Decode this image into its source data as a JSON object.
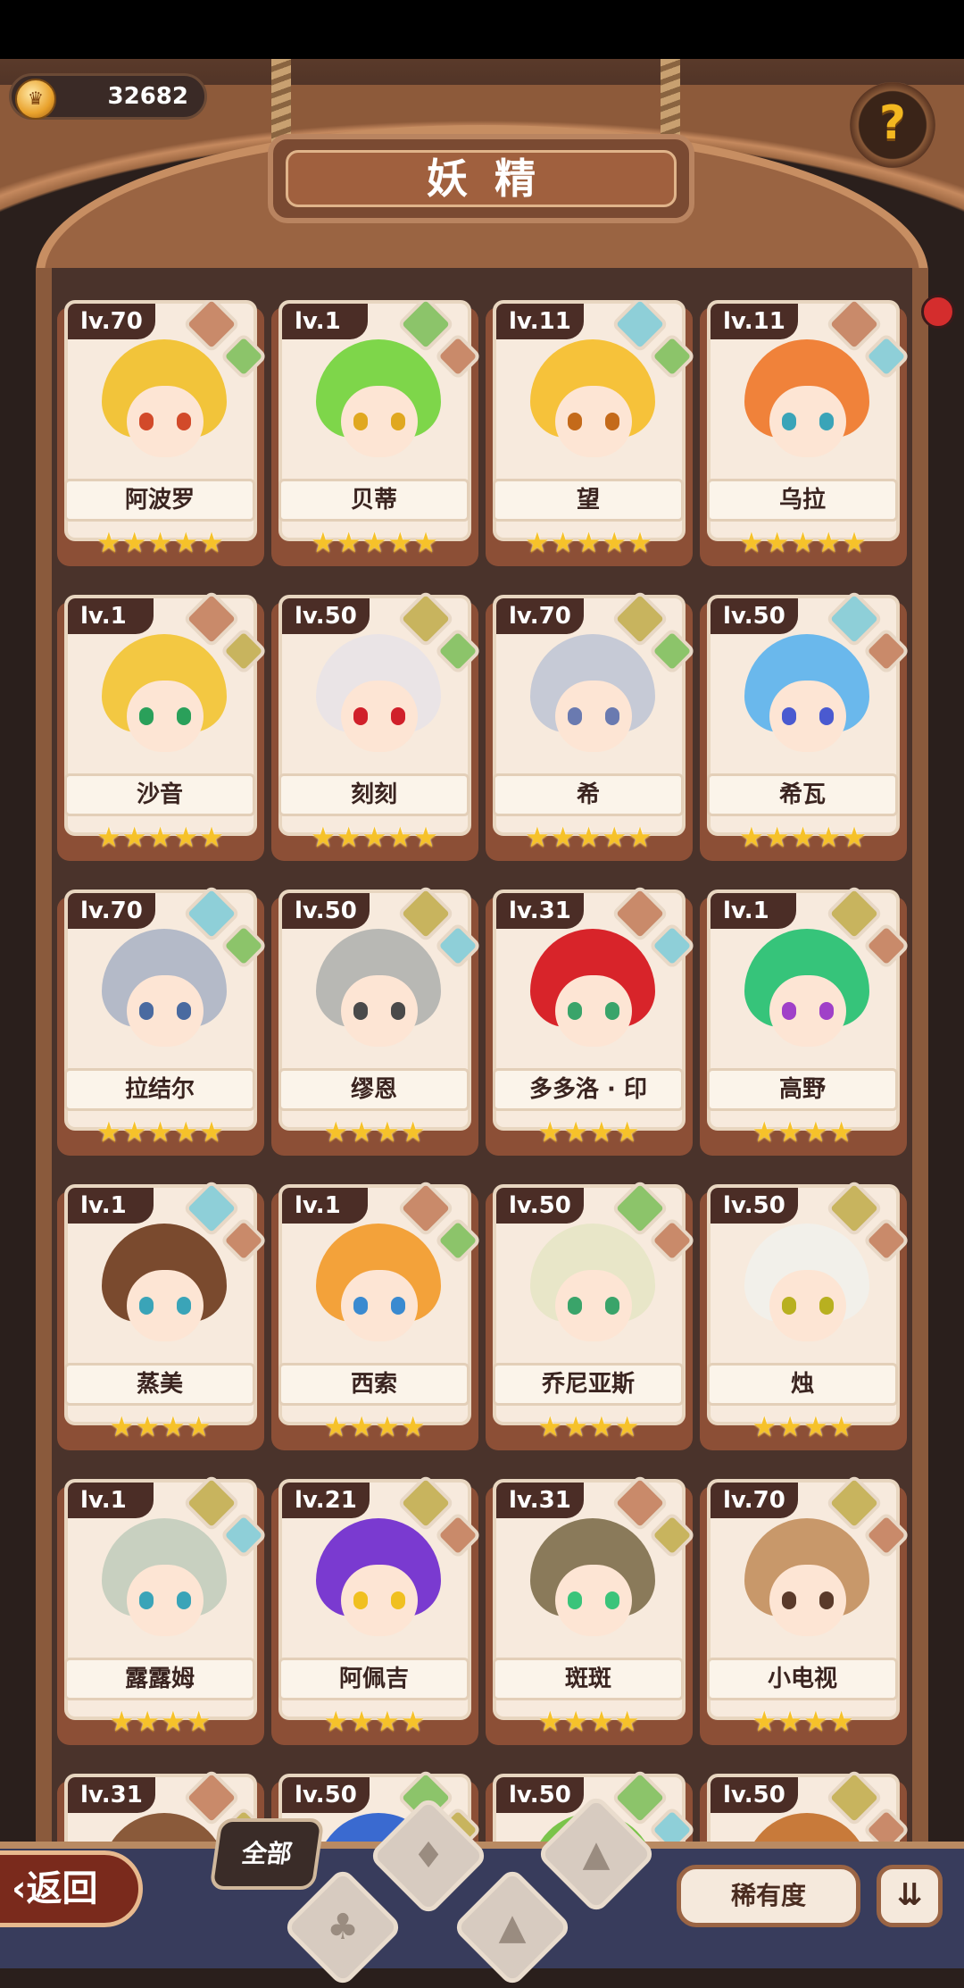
{
  "header": {
    "coins": "32682",
    "title": "妖精",
    "help_icon": "question-sprout-icon"
  },
  "colors": {
    "card_bg": "#f7eadd",
    "card_frame": "#8c4f36",
    "level_tag": "#4b2d26",
    "star": "#f6c22a",
    "bottom_bar": "#383c5c",
    "element_fire": "#c98a6a",
    "element_plant": "#8cc46a",
    "element_water": "#8ecfd8",
    "element_earth": "#c8b45e"
  },
  "fairies": [
    {
      "name": "阿波罗",
      "level": "lv.70",
      "stars": "★★★★★",
      "elements": [
        "fire",
        "plant"
      ],
      "hair": "#f2c43a",
      "eye": "#d24a2a"
    },
    {
      "name": "贝蒂",
      "level": "lv.1",
      "stars": "★★★★★",
      "elements": [
        "plant",
        "fire"
      ],
      "hair": "#7ed64a",
      "eye": "#e0a820"
    },
    {
      "name": "望",
      "level": "lv.11",
      "stars": "★★★★★",
      "elements": [
        "water",
        "plant"
      ],
      "hair": "#f6c23a",
      "eye": "#c46a1a"
    },
    {
      "name": "乌拉",
      "level": "lv.11",
      "stars": "★★★★★",
      "elements": [
        "fire",
        "water"
      ],
      "hair": "#f0823a",
      "eye": "#3aa4b8"
    },
    {
      "name": "沙音",
      "level": "lv.1",
      "stars": "★★★★★",
      "elements": [
        "fire",
        "earth"
      ],
      "hair": "#f3c842",
      "eye": "#2aa05a"
    },
    {
      "name": "刻刻",
      "level": "lv.50",
      "stars": "★★★★★",
      "elements": [
        "earth",
        "plant"
      ],
      "hair": "#eae4e6",
      "eye": "#d0202a"
    },
    {
      "name": "希",
      "level": "lv.70",
      "stars": "★★★★★",
      "elements": [
        "earth",
        "plant"
      ],
      "hair": "#c6cad6",
      "eye": "#6a7ab0"
    },
    {
      "name": "希瓦",
      "level": "lv.50",
      "stars": "★★★★★",
      "elements": [
        "water",
        "fire"
      ],
      "hair": "#6ab8ec",
      "eye": "#4a5ad0"
    },
    {
      "name": "拉结尔",
      "level": "lv.70",
      "stars": "★★★★★",
      "elements": [
        "water",
        "plant"
      ],
      "hair": "#b4bac8",
      "eye": "#4a6aa0"
    },
    {
      "name": "缪恩",
      "level": "lv.50",
      "stars": "★★★★",
      "elements": [
        "earth",
        "water"
      ],
      "hair": "#b8b8b4",
      "eye": "#4a4a4a"
    },
    {
      "name": "多多洛 · 印",
      "level": "lv.31",
      "stars": "★★★★",
      "elements": [
        "fire",
        "water"
      ],
      "hair": "#d8242a",
      "eye": "#3aa46a"
    },
    {
      "name": "高野",
      "level": "lv.1",
      "stars": "★★★★",
      "elements": [
        "earth",
        "fire"
      ],
      "hair": "#36c47a",
      "eye": "#a040c8"
    },
    {
      "name": "蒸美",
      "level": "lv.1",
      "stars": "★★★★",
      "elements": [
        "water",
        "fire"
      ],
      "hair": "#7a4a2e",
      "eye": "#3aa4b8"
    },
    {
      "name": "西索",
      "level": "lv.1",
      "stars": "★★★★",
      "elements": [
        "fire",
        "plant"
      ],
      "hair": "#f3a23a",
      "eye": "#3a8ad0"
    },
    {
      "name": "乔尼亚斯",
      "level": "lv.50",
      "stars": "★★★★",
      "elements": [
        "plant",
        "fire"
      ],
      "hair": "#e8e6c8",
      "eye": "#3aa46a"
    },
    {
      "name": "烛",
      "level": "lv.50",
      "stars": "★★★★",
      "elements": [
        "earth",
        "fire"
      ],
      "hair": "#f2f0ea",
      "eye": "#b8b020"
    },
    {
      "name": "露露姆",
      "level": "lv.1",
      "stars": "★★★★",
      "elements": [
        "earth",
        "water"
      ],
      "hair": "#c8d0c0",
      "eye": "#3aa4b8"
    },
    {
      "name": "阿佩吉",
      "level": "lv.21",
      "stars": "★★★★",
      "elements": [
        "earth",
        "fire"
      ],
      "hair": "#7a3ad0",
      "eye": "#f0c020"
    },
    {
      "name": "斑斑",
      "level": "lv.31",
      "stars": "★★★★",
      "elements": [
        "fire",
        "earth"
      ],
      "hair": "#8a7a5a",
      "eye": "#3ac47a"
    },
    {
      "name": "小电视",
      "level": "lv.70",
      "stars": "★★★★",
      "elements": [
        "earth",
        "fire"
      ],
      "hair": "#c8986a",
      "eye": "#5a3a2a"
    },
    {
      "name": "",
      "level": "lv.31",
      "stars": "",
      "elements": [
        "fire",
        "earth"
      ],
      "hair": "#8a5a3a",
      "eye": "#000"
    },
    {
      "name": "",
      "level": "lv.50",
      "stars": "",
      "elements": [
        "plant",
        "earth"
      ],
      "hair": "#3a6ad0",
      "eye": "#000"
    },
    {
      "name": "",
      "level": "lv.50",
      "stars": "",
      "elements": [
        "plant",
        "water"
      ],
      "hair": "#7ac44a",
      "eye": "#000"
    },
    {
      "name": "",
      "level": "lv.50",
      "stars": "",
      "elements": [
        "earth",
        "fire"
      ],
      "hair": "#c87a3a",
      "eye": "#000"
    }
  ],
  "bottom": {
    "back_label": "返回",
    "filter_all_label": "全部",
    "filters": [
      "all",
      "plant",
      "water",
      "fire",
      "earth"
    ],
    "sort_label": "稀有度",
    "order_icon": "sort-order-icon"
  }
}
